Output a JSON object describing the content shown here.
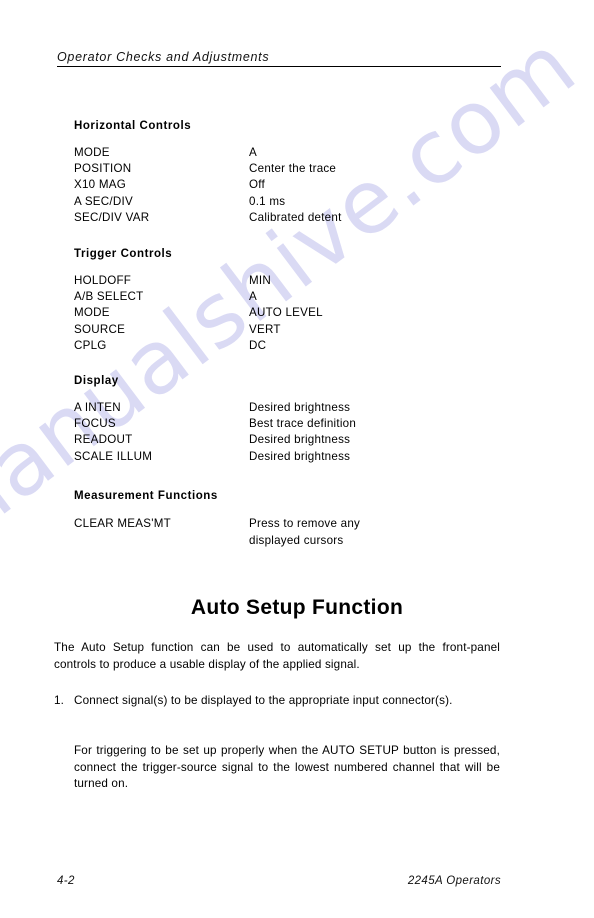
{
  "page": {
    "running_head": "Operator Checks and Adjustments",
    "watermark": "manualshive.com",
    "watermark_color": "#d9d9f4"
  },
  "groups": [
    {
      "title": "Horizontal Controls",
      "rows": [
        {
          "label": "MODE",
          "value": "A"
        },
        {
          "label": "POSITION",
          "value": "Center the trace"
        },
        {
          "label": "X10 MAG",
          "value": "Off"
        },
        {
          "label": "A SEC/DIV",
          "value": "0.1 ms"
        },
        {
          "label": "SEC/DIV VAR",
          "value": "Calibrated detent"
        }
      ]
    },
    {
      "title": "Trigger Controls",
      "rows": [
        {
          "label": "HOLDOFF",
          "value": "MIN"
        },
        {
          "label": "A/B SELECT",
          "value": "A"
        },
        {
          "label": "MODE",
          "value": "AUTO LEVEL"
        },
        {
          "label": "SOURCE",
          "value": "VERT"
        },
        {
          "label": "CPLG",
          "value": "DC"
        }
      ]
    },
    {
      "title": "Display",
      "rows": [
        {
          "label": "A INTEN",
          "value": "Desired brightness"
        },
        {
          "label": "FOCUS",
          "value": "Best trace definition"
        },
        {
          "label": "READOUT",
          "value": "Desired brightness"
        },
        {
          "label": "SCALE ILLUM",
          "value": "Desired brightness"
        }
      ]
    },
    {
      "title": "Measurement Functions",
      "rows": [
        {
          "label": "CLEAR MEAS'MT",
          "value": "Press to remove any",
          "value_line2": "displayed cursors"
        }
      ]
    }
  ],
  "section": {
    "heading": "Auto Setup Function",
    "intro": "The Auto Setup function can be used to automatically set up the front-panel controls to produce a usable display of the applied signal.",
    "steps": [
      {
        "number": "1.",
        "text": "Connect signal(s) to be displayed to the appropriate input connector(s)."
      }
    ],
    "note": "For triggering to be set up properly when the AUTO SETUP button is pressed, connect the trigger-source signal to the lowest numbered channel that will be turned on."
  },
  "footer": {
    "page_number": "4-2",
    "document": "2245A Operators"
  }
}
